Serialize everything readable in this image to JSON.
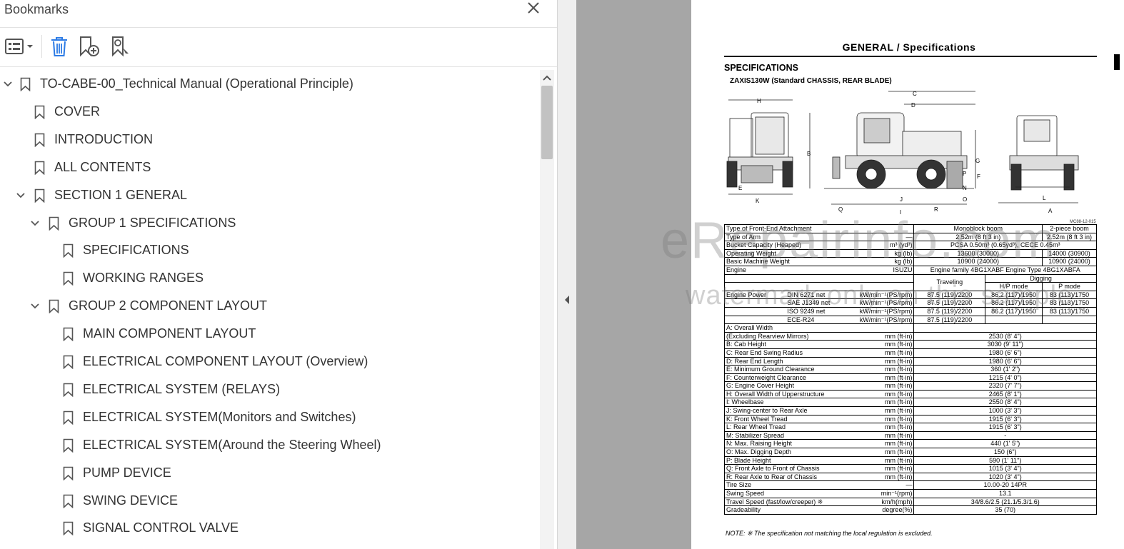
{
  "sidebar": {
    "title": "Bookmarks",
    "close_icon": "close-icon",
    "toolbar": [
      "options-menu-icon",
      "delete-bookmark-icon",
      "new-bookmark-icon",
      "find-bookmark-icon"
    ],
    "items": [
      {
        "label": "TO-CABE-00_Technical Manual (Operational Principle)",
        "level": 0,
        "expanded": true
      },
      {
        "label": "COVER",
        "level": 1
      },
      {
        "label": "INTRODUCTION",
        "level": 1
      },
      {
        "label": "ALL CONTENTS",
        "level": 1
      },
      {
        "label": "SECTION 1 GENERAL",
        "level": 1,
        "expanded": true
      },
      {
        "label": "GROUP 1 SPECIFICATIONS",
        "level": 2,
        "expanded": true
      },
      {
        "label": "SPECIFICATIONS",
        "level": 3
      },
      {
        "label": "WORKING RANGES",
        "level": 3
      },
      {
        "label": "GROUP 2 COMPONENT LAYOUT",
        "level": 2,
        "expanded": true
      },
      {
        "label": "MAIN COMPONENT LAYOUT",
        "level": 3
      },
      {
        "label": "ELECTRICAL COMPONENT LAYOUT (Overview)",
        "level": 3
      },
      {
        "label": "ELECTRICAL SYSTEM (RELAYS)",
        "level": 3
      },
      {
        "label": "ELECTRICAL SYSTEM(Monitors and Switches)",
        "level": 3
      },
      {
        "label": "ELECTRICAL SYSTEM(Around the Steering Wheel)",
        "level": 3
      },
      {
        "label": "PUMP DEVICE",
        "level": 3
      },
      {
        "label": "SWING DEVICE",
        "level": 3
      },
      {
        "label": "SIGNAL CONTROL VALVE",
        "level": 3
      }
    ]
  },
  "document": {
    "page_title": "GENERAL / Specifications",
    "section_heading": "SPECIFICATIONS",
    "model": "ZAXIS130W (Standard CHASSIS, REAR BLADE)",
    "figure_code": "MC88-12-015",
    "drawing_labels": [
      "H",
      "C",
      "D",
      "B",
      "G",
      "P",
      "F",
      "N",
      "O",
      "E",
      "K",
      "J",
      "Q",
      "I",
      "R",
      "L",
      "A"
    ],
    "table_header": [
      [
        "Type of Front-End Attachment",
        "",
        "Monoblock boom",
        "2-piece boom"
      ],
      [
        "Type of Arm",
        "—",
        "2.52m (8 ft 3 in)",
        "2.52m (8 ft 3 in)"
      ],
      [
        "Bucket Capacity (Heaped)",
        "m³ (yd³)",
        "PCSA 0.50m³ (0.65yd³), CECE 0.45m³",
        ""
      ],
      [
        "Operating Weight",
        "kg (lb)",
        "13600 (30000)",
        "14000 (30900)"
      ],
      [
        "Basic Machine Weight",
        "kg (lb)",
        "10900 (24000)",
        "10900 (24000)"
      ],
      [
        "Engine",
        "ISUZU",
        "Engine family 4BG1XABF Engine Type 4BG1XABFA",
        ""
      ]
    ],
    "engine_cols": {
      "traveling": "Traveling",
      "digging": "Digging",
      "hp_mode": "H/P mode",
      "p_mode": "P mode"
    },
    "engine_power_label": "Engine Power",
    "engine_rows": [
      [
        "DIN 6271 net",
        "kW/min⁻¹(PS/rpm)",
        "87.5 (119)/2200",
        "86.2 (117)/1950",
        "83 (113)/1750"
      ],
      [
        "SAE J1349 net",
        "kW/min⁻¹(PS/rpm)",
        "87.5 (119)/2200",
        "86.2 (117)/1950",
        "83 (113)/1750"
      ],
      [
        "ISO 9249 net",
        "kW/min⁻¹(PS/rpm)",
        "87.5 (119)/2200",
        "86.2 (117)/1950",
        "83 (113)/1750"
      ],
      [
        "ECE-R24",
        "kW/min⁻¹(PS/rpm)",
        "87.5 (119)/2200",
        "",
        ""
      ]
    ],
    "dim_rows": [
      [
        "A:  Overall                              Width",
        "",
        ""
      ],
      [
        "(Excluding Rearview Mirrors)",
        "mm (ft·in)",
        "2530 (8' 4\")"
      ],
      [
        "B:  Cab Height",
        "mm (ft·in)",
        "3030 (9' 11\")"
      ],
      [
        "C:  Rear End Swing Radius",
        "mm (ft·in)",
        "1980 (6' 6\")"
      ],
      [
        "D:  Rear End Length",
        "mm (ft·in)",
        "1980 (6' 6\")"
      ],
      [
        "E:  Minimum Ground Clearance",
        "mm (ft·in)",
        "360 (1' 2\")"
      ],
      [
        "F:  Counterweight Clearance",
        "mm (ft·in)",
        "1215 (4' 0\")"
      ],
      [
        "G:  Engine Cover Height",
        "mm (ft·in)",
        "2320 (7' 7\")"
      ],
      [
        "H:  Overall Width of Upperstructure",
        "mm (ft·in)",
        "2465 (8' 1\")"
      ],
      [
        "I:   Wheelbase",
        "mm (ft·in)",
        "2550 (8' 4\")"
      ],
      [
        "J:  Swing-center to Rear Axle",
        "mm (ft·in)",
        "1000 (3' 3\")"
      ],
      [
        "K:  Front Wheel Tread",
        "mm (ft·in)",
        "1915 (6' 3\")"
      ],
      [
        "L:  Rear Wheel Tread",
        "mm (ft·in)",
        "1915 (6' 3\")"
      ],
      [
        "M:  Stabilizer Spread",
        "mm (ft·in)",
        "-"
      ],
      [
        "N:  Max. Raising Height",
        "mm (ft·in)",
        "440 (1' 5\")"
      ],
      [
        "O:  Max. Digging Depth",
        "mm (ft·in)",
        "150 (6\")"
      ],
      [
        "P:  Blade Height",
        "mm (ft·in)",
        "590 (1' 11\")"
      ],
      [
        "Q:  Front Axle to Front of Chassis",
        "mm (ft·in)",
        "1015 (3' 4\")"
      ],
      [
        "R:  Rear Axle to Rear of Chassis",
        "mm (ft·in)",
        "1020 (3' 4\")"
      ],
      [
        "Tire Size",
        "—",
        "10.00-20 14PR"
      ],
      [
        "Swing Speed",
        "min⁻¹(rpm)",
        "13.1"
      ],
      [
        "Travel Speed (fast/low/creeper)  ※",
        "km/h(mph)",
        "34/8.6/2.5 (21.1/5.3/1.6)"
      ],
      [
        "Gradeability",
        "degree(%)",
        "35 (70)"
      ]
    ],
    "note": "NOTE:  ※  The specification not matching the local regulation is excluded."
  },
  "watermark": {
    "line1": "eRepairinfo.com",
    "line2": "watermark only on this sample"
  }
}
